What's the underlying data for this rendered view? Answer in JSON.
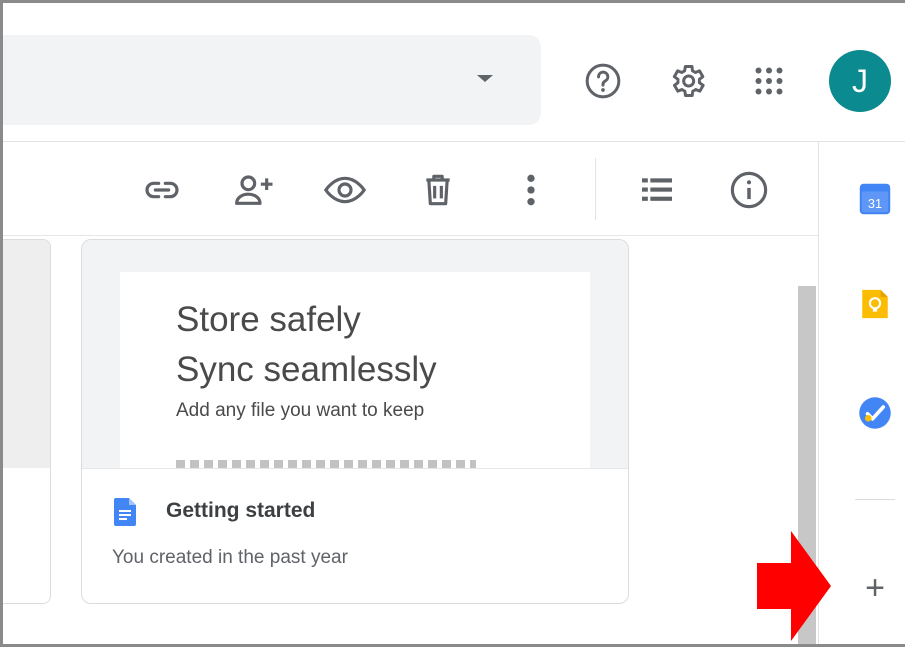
{
  "header": {
    "avatar_letter": "J",
    "icons": [
      "help-icon",
      "gear-icon",
      "apps-grid-icon"
    ]
  },
  "toolbar": {
    "icons": [
      "link-icon",
      "add-person-icon",
      "preview-eye-icon",
      "trash-icon",
      "more-vert-icon",
      "list-view-icon",
      "info-icon"
    ]
  },
  "card": {
    "preview_line1": "Store safely",
    "preview_line2": "Sync seamlessly",
    "preview_line3": "Add any file you want to keep",
    "title": "Getting started",
    "subtitle": "You created in the past year"
  },
  "side_panel": {
    "apps": [
      "calendar-icon",
      "keep-icon",
      "tasks-icon"
    ],
    "calendar_day": "31",
    "add_label": "+"
  },
  "colors": {
    "accent_blue": "#4285f4",
    "avatar_teal": "#0b8a8f",
    "annotation_red": "#ff0000",
    "keep_yellow": "#fbbc04"
  }
}
